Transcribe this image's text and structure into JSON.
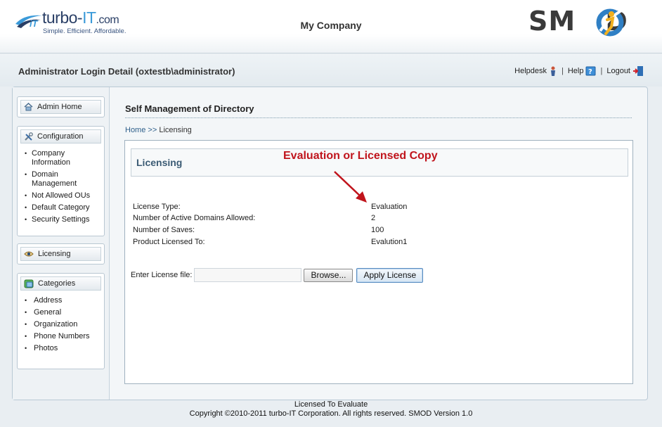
{
  "header": {
    "brand_left_main": "turbo-",
    "brand_left_accent": "IT",
    "brand_left_suffix": ".com",
    "brand_left_mark": "iT",
    "tagline": "Simple. Efficient. Affordable.",
    "company": "My Company",
    "brand_right_pre": "SM",
    "brand_right_post": "D"
  },
  "login_bar": {
    "title": "Administrator Login Detail (oxtestb\\administrator)",
    "links": {
      "helpdesk": "Helpdesk",
      "help": "Help",
      "logout": "Logout",
      "separator": "|"
    }
  },
  "sidebar": {
    "admin_home": "Admin Home",
    "configuration": {
      "title": "Configuration",
      "items": [
        "Company Information",
        "Domain Management",
        "Not Allowed OUs",
        "Default Category",
        "Security Settings"
      ]
    },
    "licensing": "Licensing",
    "categories": {
      "title": "Categories",
      "items": [
        "Address",
        "General",
        "Organization",
        "Phone Numbers",
        "Photos"
      ]
    }
  },
  "main": {
    "title": "Self Management of Directory",
    "breadcrumb": {
      "home": "Home",
      "arrow": ">>",
      "current": "Licensing"
    },
    "panel_title": "Licensing",
    "annotation": "Evaluation or Licensed Copy",
    "info": [
      {
        "label": "License Type:",
        "value": "Evaluation"
      },
      {
        "label": "Number of Active Domains Allowed:",
        "value": "2"
      },
      {
        "label": "Number of Saves:",
        "value": "100"
      },
      {
        "label": "Product Licensed To:",
        "value": "Evalution1"
      }
    ],
    "license_file": {
      "label": "Enter License file:",
      "value": "",
      "browse": "Browse...",
      "apply": "Apply License"
    }
  },
  "footer": {
    "line1": "Licensed To Evaluate",
    "line2": "Copyright ©2010-2011 turbo-IT Corporation. All rights reserved. SMOD Version 1.0"
  },
  "colors": {
    "annotation": "#c0141c",
    "panel_title": "#3b5b74",
    "link": "#2e5f8a",
    "smod_o_ring": "#2f7fc4",
    "smod_o_figure": "#f2b01e"
  },
  "icons": {
    "admin_home": "house-icon",
    "configuration": "tools-icon",
    "licensing": "eye-icon",
    "categories": "categories-icon",
    "helpdesk": "person-icon",
    "help": "help-book-icon",
    "logout": "logout-door-icon"
  }
}
